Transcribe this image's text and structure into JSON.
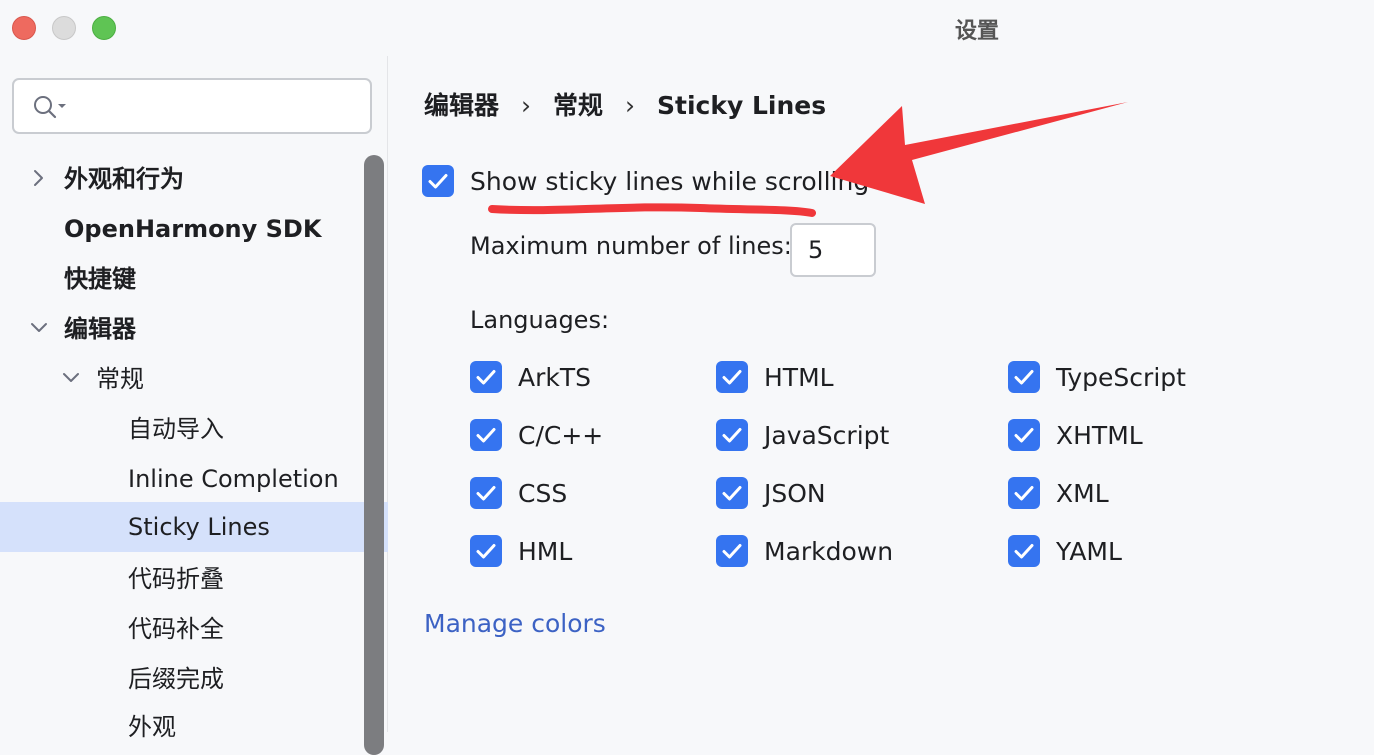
{
  "window": {
    "title": "设置"
  },
  "search": {
    "placeholder": ""
  },
  "sidebar": {
    "items": [
      {
        "label": "外观和行为",
        "chevron": "right"
      },
      {
        "label": "OpenHarmony SDK"
      },
      {
        "label": "快捷键"
      },
      {
        "label": "编辑器",
        "chevron": "down"
      },
      {
        "label": "常规",
        "chevron": "down"
      },
      {
        "label": "自动导入"
      },
      {
        "label": "Inline Completion"
      },
      {
        "label": "Sticky Lines",
        "selected": true
      },
      {
        "label": "代码折叠"
      },
      {
        "label": "代码补全"
      },
      {
        "label": "后缀完成"
      },
      {
        "label": "外观"
      }
    ]
  },
  "breadcrumb": [
    "编辑器",
    "常规",
    "Sticky Lines"
  ],
  "main": {
    "show_sticky": {
      "label": "Show sticky lines while scrolling",
      "checked": true
    },
    "max_lines": {
      "label": "Maximum number of lines:",
      "value": "5"
    },
    "languages_label": "Languages:",
    "languages": [
      {
        "name": "ArkTS",
        "checked": true
      },
      {
        "name": "HTML",
        "checked": true
      },
      {
        "name": "TypeScript",
        "checked": true
      },
      {
        "name": "C/C++",
        "checked": true
      },
      {
        "name": "JavaScript",
        "checked": true
      },
      {
        "name": "XHTML",
        "checked": true
      },
      {
        "name": "CSS",
        "checked": true
      },
      {
        "name": "JSON",
        "checked": true
      },
      {
        "name": "XML",
        "checked": true
      },
      {
        "name": "HML",
        "checked": true
      },
      {
        "name": "Markdown",
        "checked": true
      },
      {
        "name": "YAML",
        "checked": true
      }
    ],
    "manage_colors": "Manage colors"
  },
  "colors": {
    "accent": "#3574f0",
    "selection": "#d5e1fb",
    "link": "#3c62c4",
    "annotation": "#f0373a"
  },
  "icons": {
    "search": "search-icon",
    "check": "checkmark-icon",
    "chevron_right": "chevron-right-icon",
    "chevron_down": "chevron-down-icon"
  }
}
